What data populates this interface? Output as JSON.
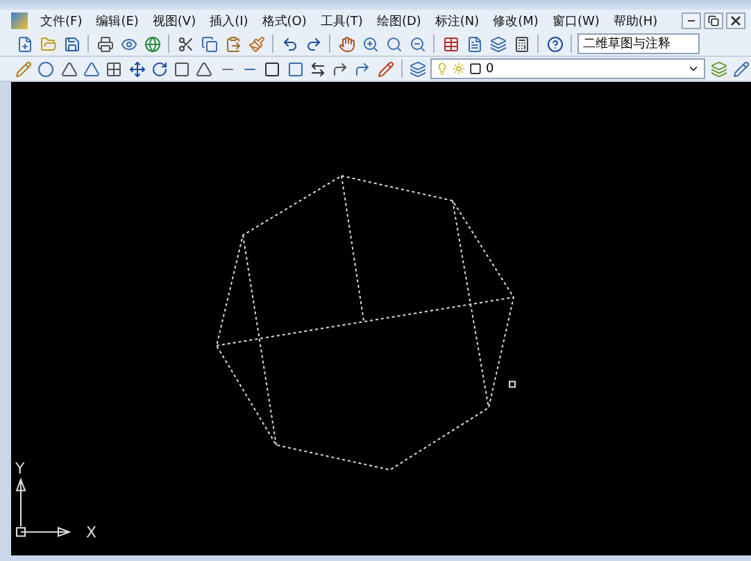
{
  "menu": [
    {
      "label": "文件(F)"
    },
    {
      "label": "编辑(E)"
    },
    {
      "label": "视图(V)"
    },
    {
      "label": "插入(I)"
    },
    {
      "label": "格式(O)"
    },
    {
      "label": "工具(T)"
    },
    {
      "label": "绘图(D)"
    },
    {
      "label": "标注(N)"
    },
    {
      "label": "修改(M)"
    },
    {
      "label": "窗口(W)"
    },
    {
      "label": "帮助(H)"
    }
  ],
  "workspace": {
    "value": "二维草图与注释"
  },
  "layer": {
    "value": "0"
  },
  "ucs": {
    "x_label": "X",
    "y_label": "Y"
  }
}
